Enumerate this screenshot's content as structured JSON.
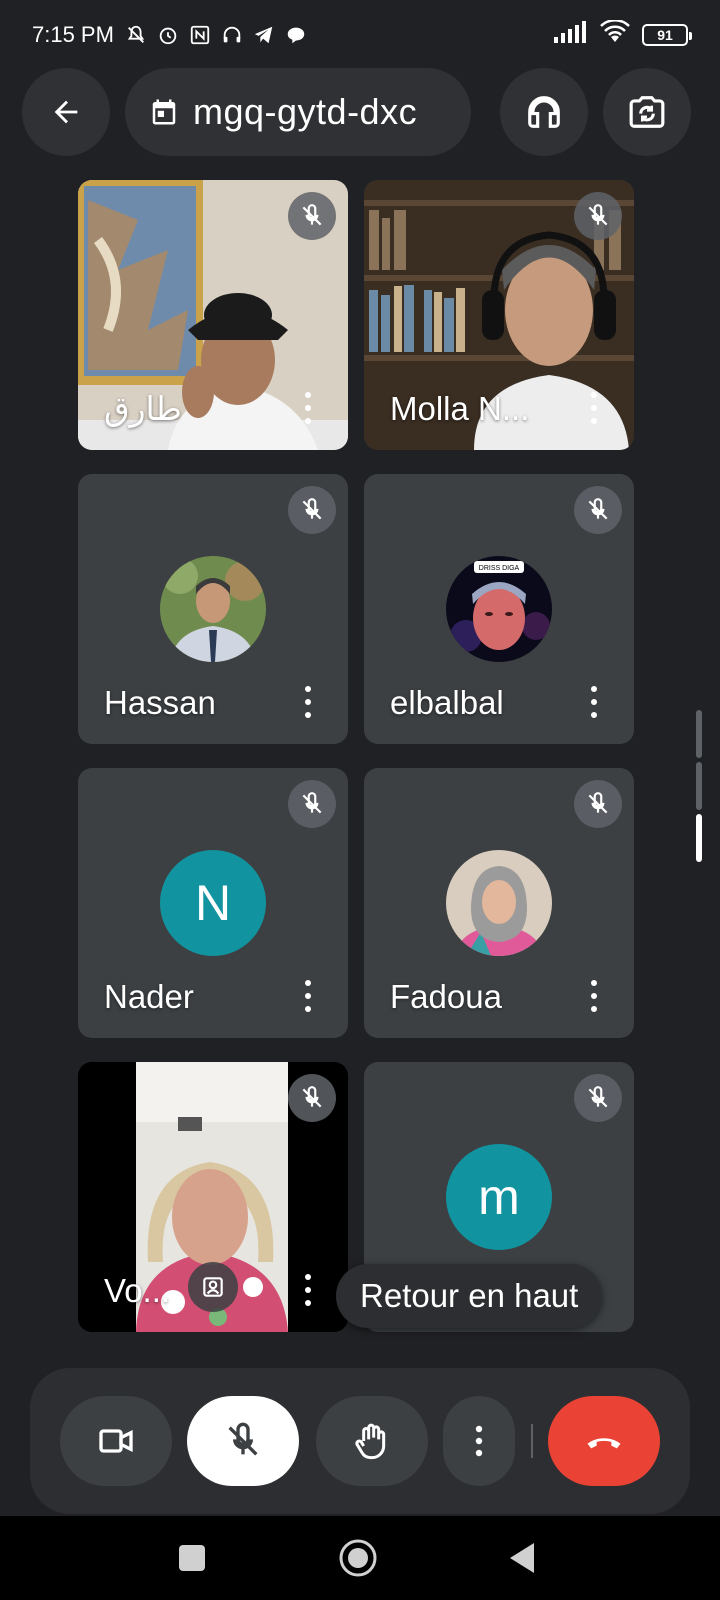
{
  "status_bar": {
    "time": "7:15 PM",
    "battery": "91",
    "icons": [
      "silent-icon",
      "alarm-icon",
      "nfc-icon",
      "headset-icon",
      "telegram-icon",
      "chat-icon",
      "signal-icon",
      "wifi-icon",
      "battery-icon"
    ]
  },
  "top_bar": {
    "meeting_code": "mgq-gytd-dxc"
  },
  "participants": [
    {
      "name": "طارق",
      "type": "video",
      "muted": true
    },
    {
      "name": "Molla N...",
      "type": "video",
      "muted": true
    },
    {
      "name": "Hassan",
      "type": "photo",
      "muted": true
    },
    {
      "name": "elbalbal",
      "type": "photo",
      "avatar_text": "DRISS DIGA",
      "muted": true
    },
    {
      "name": "Nader",
      "type": "letter",
      "letter": "N",
      "muted": true
    },
    {
      "name": "Fadoua",
      "type": "photo",
      "muted": true
    },
    {
      "name": "Vo...",
      "type": "video",
      "muted": true
    },
    {
      "name": "",
      "type": "letter",
      "letter": "m",
      "muted": true
    }
  ],
  "back_to_top": "Retour en haut",
  "colors": {
    "background": "#202124",
    "tile": "#3c4043",
    "letter_avatar": "#1294a0",
    "end_call": "#ea4335"
  }
}
